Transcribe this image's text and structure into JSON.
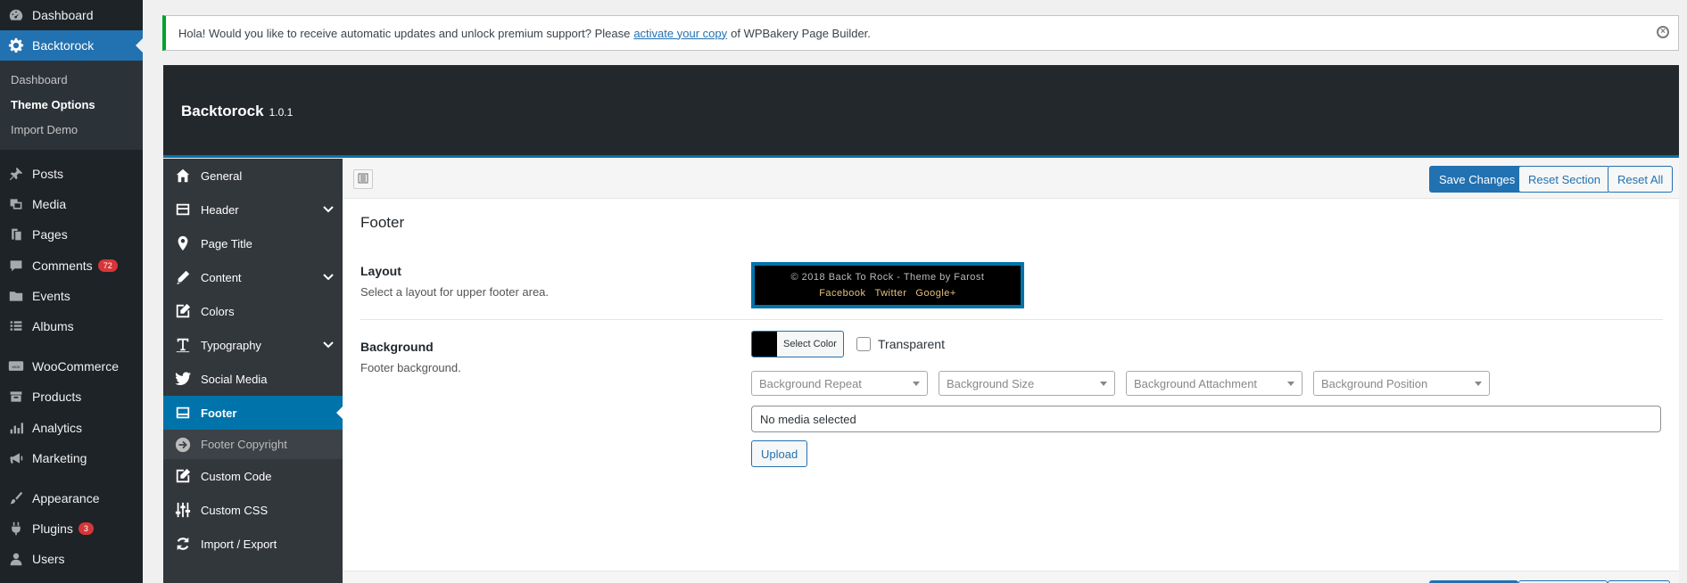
{
  "sidebar": {
    "items": [
      {
        "label": "Dashboard",
        "icon": "dashboard-icon"
      },
      {
        "label": "Backtorock",
        "icon": "gear-icon"
      },
      {
        "label": "Posts",
        "icon": "pin-icon"
      },
      {
        "label": "Media",
        "icon": "media-icon"
      },
      {
        "label": "Pages",
        "icon": "pages-icon"
      },
      {
        "label": "Comments",
        "icon": "comment-icon",
        "badge": "72"
      },
      {
        "label": "Events",
        "icon": "folder-icon"
      },
      {
        "label": "Albums",
        "icon": "list-icon"
      },
      {
        "label": "WooCommerce",
        "icon": "woo-icon"
      },
      {
        "label": "Products",
        "icon": "archive-icon"
      },
      {
        "label": "Analytics",
        "icon": "chart-icon"
      },
      {
        "label": "Marketing",
        "icon": "megaphone-icon"
      },
      {
        "label": "Appearance",
        "icon": "brush-icon"
      },
      {
        "label": "Plugins",
        "icon": "plug-icon",
        "badge": "3"
      },
      {
        "label": "Users",
        "icon": "user-icon"
      }
    ],
    "submenu": [
      "Dashboard",
      "Theme Options",
      "Import Demo"
    ]
  },
  "notice": {
    "text_before": "Hola! Would you like to receive automatic updates and unlock premium support? Please",
    "link": "activate your copy",
    "text_after": "of WPBakery Page Builder."
  },
  "panel": {
    "title": "Backtorock",
    "version": "1.0.1",
    "nav": [
      {
        "label": "General",
        "icon": "home-icon"
      },
      {
        "label": "Header",
        "icon": "header-icon",
        "expandable": true
      },
      {
        "label": "Page Title",
        "icon": "location-icon"
      },
      {
        "label": "Content",
        "icon": "pencil-icon",
        "expandable": true
      },
      {
        "label": "Colors",
        "icon": "edit-icon"
      },
      {
        "label": "Typography",
        "icon": "text-icon",
        "expandable": true
      },
      {
        "label": "Social Media",
        "icon": "twitter-icon"
      },
      {
        "label": "Footer",
        "icon": "footer-icon",
        "active": true
      },
      {
        "label": "Footer Copyright",
        "icon": "arrow-right-icon",
        "sub": true
      },
      {
        "label": "Custom Code",
        "icon": "code-edit-icon"
      },
      {
        "label": "Custom CSS",
        "icon": "sliders-icon"
      },
      {
        "label": "Import / Export",
        "icon": "refresh-icon"
      }
    ],
    "toolbar": {
      "save": "Save Changes",
      "reset_section": "Reset Section",
      "reset_all": "Reset All"
    },
    "section_title": "Footer",
    "layout": {
      "title": "Layout",
      "desc": "Select a layout for upper footer area.",
      "preview_copyright": "© 2018 Back To Rock - Theme by Farost",
      "preview_links": [
        "Facebook",
        "Twitter",
        "Google+"
      ]
    },
    "background": {
      "title": "Background",
      "desc": "Footer background.",
      "color_button": "Select Color",
      "swatch_color": "#000000",
      "transparent_label": "Transparent",
      "selects": [
        "Background Repeat",
        "Background Size",
        "Background Attachment",
        "Background Position"
      ],
      "media_value": "No media selected",
      "upload": "Upload"
    }
  }
}
